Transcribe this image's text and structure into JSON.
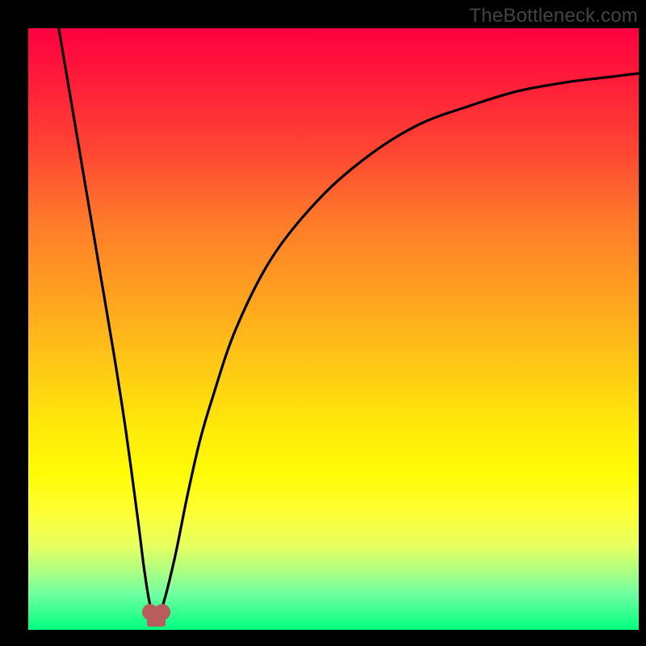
{
  "watermark": "TheBottleneck.com",
  "chart_data": {
    "type": "line",
    "title": "",
    "xlabel": "",
    "ylabel": "",
    "xlim": [
      0,
      100
    ],
    "ylim": [
      0,
      100
    ],
    "series": [
      {
        "name": "curve",
        "x": [
          5,
          8,
          10,
          12,
          14,
          16,
          18,
          19,
          20,
          21,
          22,
          24,
          26,
          28,
          30,
          34,
          40,
          48,
          56,
          64,
          72,
          80,
          88,
          96,
          100
        ],
        "y": [
          100,
          82,
          70,
          58,
          46,
          33,
          18,
          10,
          4,
          3,
          4,
          12,
          22,
          31,
          38,
          50,
          62,
          72,
          79,
          84,
          87,
          89.5,
          91,
          92,
          92.5
        ]
      }
    ],
    "markers": [
      {
        "name": "min-left",
        "x": 20,
        "y": 3
      },
      {
        "name": "min-right",
        "x": 22,
        "y": 3
      }
    ]
  },
  "colors": {
    "curve": "#000000",
    "marker": "#b85c5c"
  }
}
